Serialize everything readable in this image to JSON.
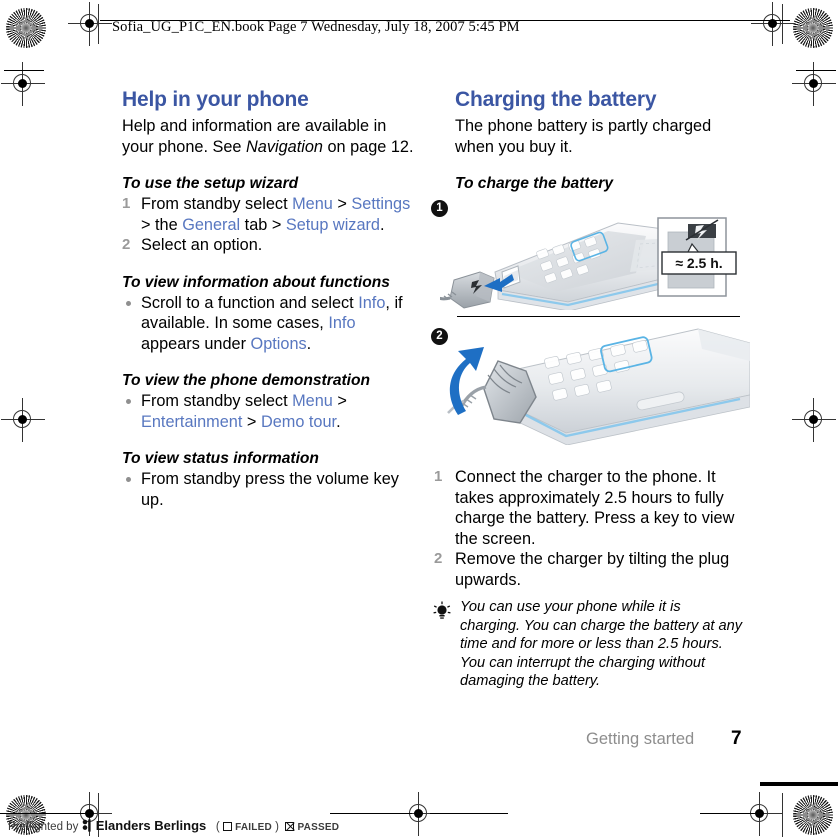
{
  "header": {
    "slug": "Sofia_UG_P1C_EN.book  Page 7  Wednesday, July 18, 2007  5:45 PM"
  },
  "colors": {
    "heading_blue": "#3b56a3",
    "link_blue": "#5877c0",
    "list_marker_gray": "#9a9a9a",
    "footer_gray": "#8d8d8d"
  },
  "left_column": {
    "heading": "Help in your phone",
    "intro_parts": {
      "a": "Help and information are available in your phone. See ",
      "b": "Navigation",
      "c": " on page 12."
    },
    "sections": [
      {
        "subhead": "To use the setup wizard",
        "type": "ordered",
        "items": [
          {
            "num": "1",
            "parts": [
              {
                "t": "From standby select ",
                "style": "plain"
              },
              {
                "t": "Menu",
                "style": "link"
              },
              {
                "t": " > ",
                "style": "plain"
              },
              {
                "t": "Settings",
                "style": "link"
              },
              {
                "t": " > the ",
                "style": "plain"
              },
              {
                "t": "General",
                "style": "link"
              },
              {
                "t": " tab > ",
                "style": "plain"
              },
              {
                "t": "Setup wizard",
                "style": "link"
              },
              {
                "t": ".",
                "style": "plain"
              }
            ]
          },
          {
            "num": "2",
            "parts": [
              {
                "t": "Select an option.",
                "style": "plain"
              }
            ]
          }
        ]
      },
      {
        "subhead": "To view information about functions",
        "type": "bullet",
        "items": [
          {
            "parts": [
              {
                "t": "Scroll to a function and select ",
                "style": "plain"
              },
              {
                "t": "Info",
                "style": "link"
              },
              {
                "t": ", if available. In some cases, ",
                "style": "plain"
              },
              {
                "t": "Info",
                "style": "link"
              },
              {
                "t": " appears under ",
                "style": "plain"
              },
              {
                "t": "Options",
                "style": "link"
              },
              {
                "t": ".",
                "style": "plain"
              }
            ]
          }
        ]
      },
      {
        "subhead": "To view the phone demonstration",
        "type": "bullet",
        "items": [
          {
            "parts": [
              {
                "t": "From standby select ",
                "style": "plain"
              },
              {
                "t": "Menu",
                "style": "link"
              },
              {
                "t": " > ",
                "style": "plain"
              },
              {
                "t": "Entertainment",
                "style": "link"
              },
              {
                "t": " > ",
                "style": "plain"
              },
              {
                "t": "Demo tour",
                "style": "link"
              },
              {
                "t": ".",
                "style": "plain"
              }
            ]
          }
        ]
      },
      {
        "subhead": "To view status information",
        "type": "bullet",
        "items": [
          {
            "parts": [
              {
                "t": "From standby press the volume key up.",
                "style": "plain"
              }
            ]
          }
        ]
      }
    ]
  },
  "right_column": {
    "heading": "Charging the battery",
    "intro": "The phone battery is partly charged when you buy it.",
    "subhead": "To charge the battery",
    "figures": [
      {
        "badge": "1",
        "caption_alt": "Charger plug being inserted into the phone connector",
        "callout": "≈  2.5 h."
      },
      {
        "badge": "2",
        "caption_alt": "Charger plug being tilted upwards to remove it from the phone"
      }
    ],
    "steps": [
      {
        "num": "1",
        "text": "Connect the charger to the phone. It takes approximately 2.5 hours to fully charge the battery. Press a key to view the screen."
      },
      {
        "num": "2",
        "text": "Remove the charger by tilting the plug upwards."
      }
    ],
    "tip": "You can use your phone while it is charging. You can charge the battery at any time and for more or less than 2.5 hours. You can interrupt the charging without damaging the battery."
  },
  "footer": {
    "section": "Getting started",
    "page": "7"
  },
  "preflight": {
    "prefix": "Preflighted by",
    "company": "Elanders Berlings",
    "open_paren": "(",
    "failed_label": "FAILED",
    "close_paren": ")",
    "passed_label": "PASSED"
  }
}
